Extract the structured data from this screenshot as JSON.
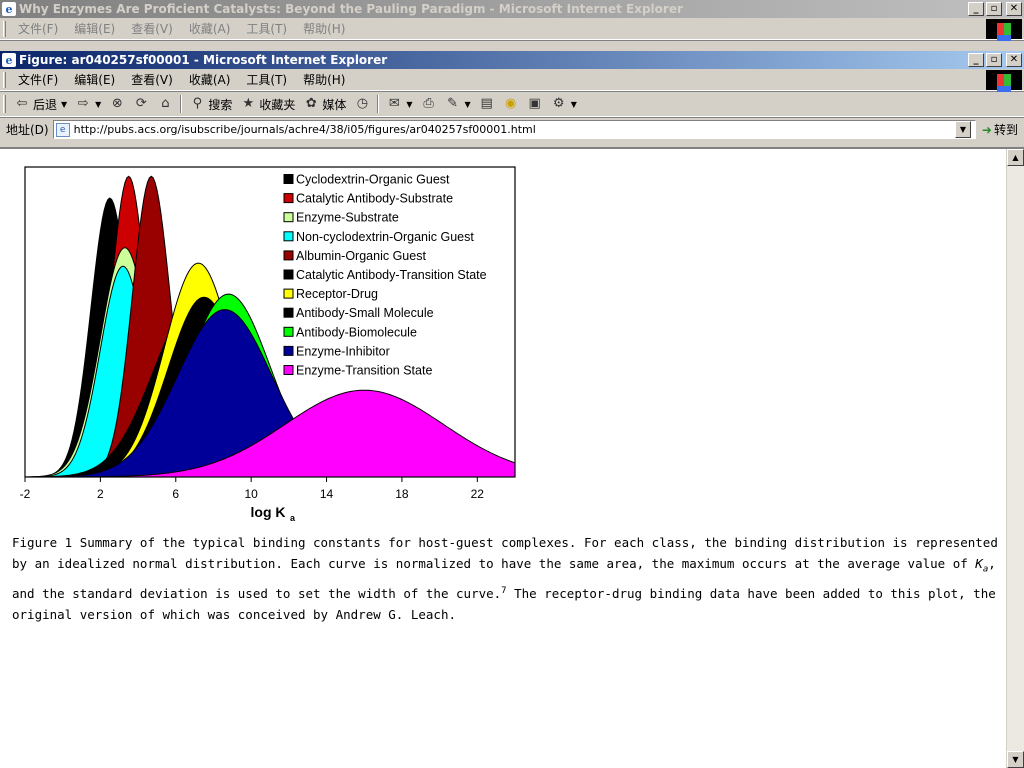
{
  "bg_window": {
    "title": "Why Enzymes Are Proficient Catalysts: Beyond the Pauling Paradigm - Microsoft Internet Explorer",
    "menus": [
      "文件(F)",
      "编辑(E)",
      "查看(V)",
      "收藏(A)",
      "工具(T)",
      "帮助(H)"
    ]
  },
  "window": {
    "title": "Figure: ar040257sf00001 - Microsoft Internet Explorer",
    "menus": [
      "文件(F)",
      "编辑(E)",
      "查看(V)",
      "收藏(A)",
      "工具(T)",
      "帮助(H)"
    ],
    "toolbar": {
      "back": "后退",
      "search": "搜索",
      "favorites": "收藏夹",
      "media": "媒体"
    },
    "address": {
      "label": "地址(D)",
      "url": "http://pubs.acs.org/isubscribe/journals/achre4/38/i05/figures/ar040257sf00001.html",
      "go": "转到"
    }
  },
  "chart_data": {
    "type": "area",
    "xlabel": "log K",
    "xlabel_sub": "a",
    "xlim": [
      -2,
      24
    ],
    "xticks": [
      -2,
      2,
      6,
      10,
      14,
      18,
      22
    ],
    "x_tick_labels": [
      "-2",
      "2",
      "6",
      "10",
      "14",
      "18",
      "22"
    ],
    "legend_position": "top-right",
    "series": [
      {
        "name": "Cyclodextrin-Organic Guest",
        "color": "#000000",
        "mean": 2.5,
        "sd": 1.0,
        "peak": 0.9
      },
      {
        "name": "Catalytic Antibody-Substrate",
        "color": "#cc0000",
        "mean": 3.5,
        "sd": 0.95,
        "peak": 0.97
      },
      {
        "name": "Enzyme-Substrate",
        "color": "#ccff99",
        "mean": 3.3,
        "sd": 1.3,
        "peak": 0.74
      },
      {
        "name": "Non-cyclodextrin-Organic Guest",
        "color": "#00ffff",
        "mean": 3.2,
        "sd": 1.2,
        "peak": 0.68
      },
      {
        "name": "Albumin-Organic Guest",
        "color": "#990000",
        "mean": 4.7,
        "sd": 1.0,
        "peak": 0.97
      },
      {
        "name": "Catalytic Antibody-Transition State",
        "color": "#000000",
        "mean": 7.0,
        "sd": 2.2,
        "peak": 0.56
      },
      {
        "name": "Receptor-Drug",
        "color": "#ffff00",
        "mean": 7.2,
        "sd": 1.8,
        "peak": 0.69
      },
      {
        "name": "Antibody-Small Molecule",
        "color": "#000000",
        "mean": 7.5,
        "sd": 1.9,
        "peak": 0.58
      },
      {
        "name": "Antibody-Biomolecule",
        "color": "#00ff00",
        "mean": 8.8,
        "sd": 2.2,
        "peak": 0.59
      },
      {
        "name": "Enzyme-Inhibitor",
        "color": "#000099",
        "mean": 8.6,
        "sd": 2.5,
        "peak": 0.54
      },
      {
        "name": "Enzyme-Transition State",
        "color": "#ff00ff",
        "mean": 16.0,
        "sd": 4.2,
        "peak": 0.28
      }
    ]
  },
  "caption": {
    "part1": "Figure 1 Summary of the typical binding constants for host-guest complexes. For each class, the binding distribution is represented by an idealized normal distribution. Each curve is normalized to have the same area, the maximum occurs at the average value of ",
    "ka_main": "K",
    "ka_sub": "a",
    "part2": ", and the standard deviation is used to set the width of the curve.",
    "ref": "7",
    "part3": " The receptor-drug binding data have been added to this plot, the original version of which was conceived by Andrew G. Leach."
  }
}
